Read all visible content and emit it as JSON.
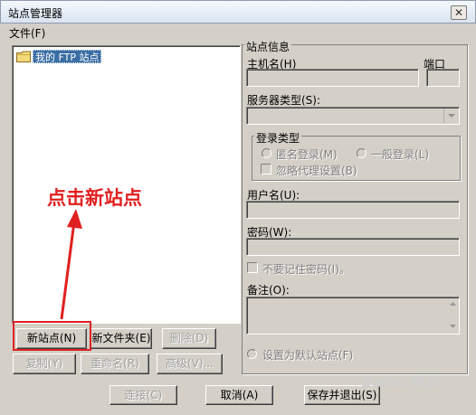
{
  "window": {
    "title": "站点管理器",
    "close_glyph": "✕"
  },
  "menu": {
    "file": "文件(F)"
  },
  "tree": {
    "root_label": "我的 FTP 站点"
  },
  "left_buttons": {
    "new_site": "新站点(N)",
    "new_folder": "新文件夹(E)",
    "delete": "删除(D)",
    "copy": "复制(Y)",
    "rename": "重命名(R)",
    "advanced": "高级(V)..."
  },
  "site_info": {
    "group_title": "站点信息",
    "host_label": "主机名(H)",
    "port_label": "端口",
    "server_type_label": "服务器类型(S):",
    "login_group_title": "登录类型",
    "anonymous_label": "匿名登录(M)",
    "normal_label": "一般登录(L)",
    "ignore_proxy_label": "忽略代理设置(B)",
    "username_label": "用户名(U):",
    "password_label": "密码(W):",
    "no_save_password_label": "不要记住密码(I)。",
    "notes_label": "备注(O):",
    "default_site_label": "设置为默认站点(F)"
  },
  "bottom_buttons": {
    "connect": "连接(C)",
    "cancel": "取消(A)",
    "save_exit": "保存并退出(S)"
  },
  "annotation": {
    "text": "点击新站点",
    "color": "#e02020"
  },
  "watermark": {
    "text": "Baidu 经验"
  }
}
